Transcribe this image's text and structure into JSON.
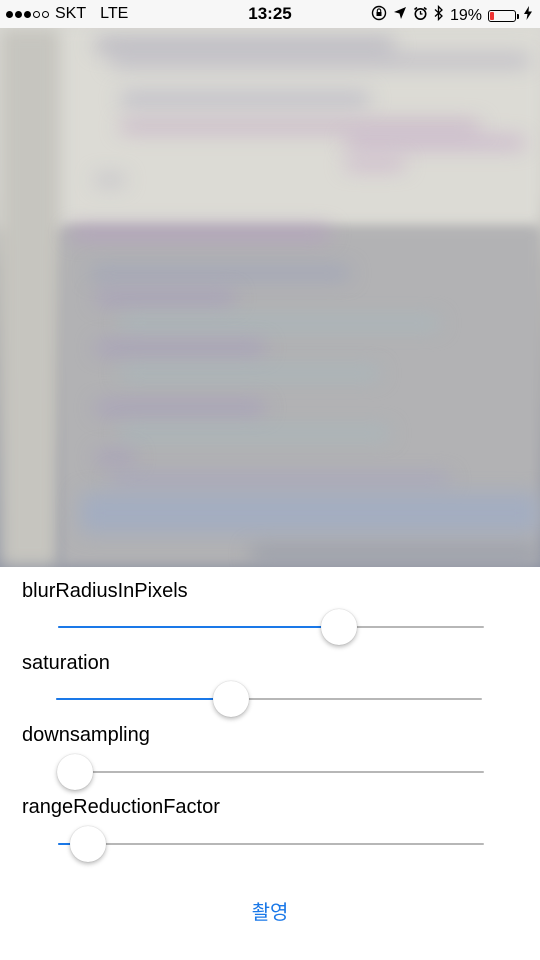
{
  "status_bar": {
    "carrier": "SKT",
    "network": "LTE",
    "time": "13:25",
    "battery": "19%",
    "battery_level": 0.19,
    "signal_bars": 3,
    "signal_total": 5,
    "icons": [
      "orientation-lock-icon",
      "location-arrow-icon",
      "alarm-icon",
      "bluetooth-icon",
      "battery-icon",
      "charging-bolt-icon"
    ]
  },
  "preview": {
    "description_icon": "camera-preview"
  },
  "sliders": [
    {
      "label": "blurRadiusInPixels",
      "value": 0.66
    },
    {
      "label": "saturation",
      "value": 0.41
    },
    {
      "label": "downsampling",
      "value": 0.04
    },
    {
      "label": "rangeReductionFactor",
      "value": 0.07
    }
  ],
  "capture": {
    "label": "촬영"
  },
  "colors": {
    "accent": "#1a78e8",
    "track": "#b7b7b7"
  }
}
